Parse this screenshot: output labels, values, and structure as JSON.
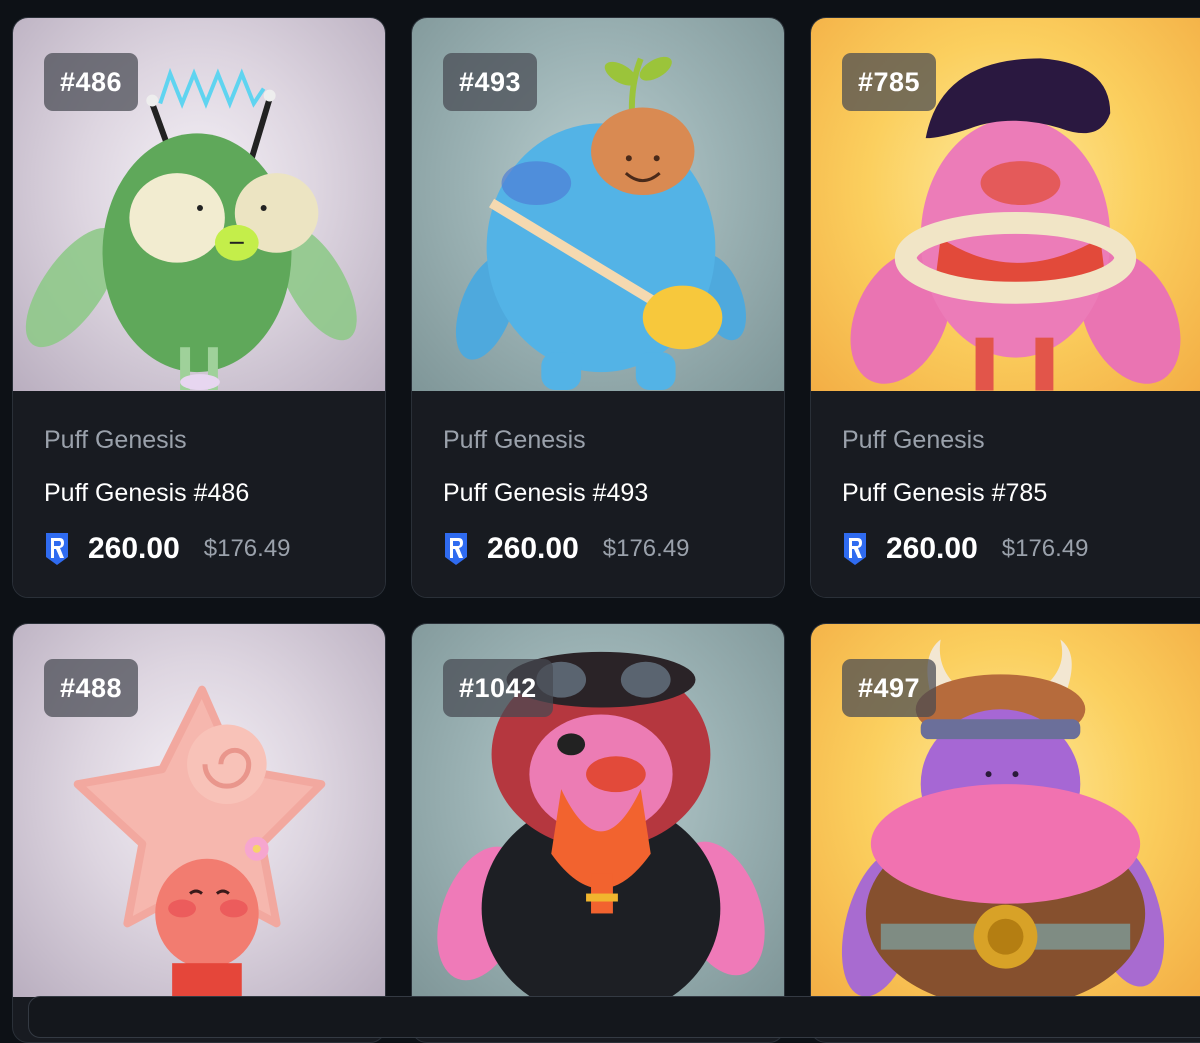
{
  "colors": {
    "page_bg": "#0d1116",
    "card_bg": "#181b21",
    "muted_text": "#9aa1ab",
    "token_blue": "#2f6bf0"
  },
  "cards": [
    {
      "badge": "#486",
      "collection": "Puff Genesis",
      "name": "Puff Genesis #486",
      "price": "260.00",
      "usd": "$176.49",
      "token_icon": "token-icon"
    },
    {
      "badge": "#493",
      "collection": "Puff Genesis",
      "name": "Puff Genesis #493",
      "price": "260.00",
      "usd": "$176.49",
      "token_icon": "token-icon"
    },
    {
      "badge": "#785",
      "collection": "Puff Genesis",
      "name": "Puff Genesis #785",
      "price": "260.00",
      "usd": "$176.49",
      "token_icon": "token-icon"
    },
    {
      "badge": "#488"
    },
    {
      "badge": "#1042"
    },
    {
      "badge": "#497"
    }
  ]
}
